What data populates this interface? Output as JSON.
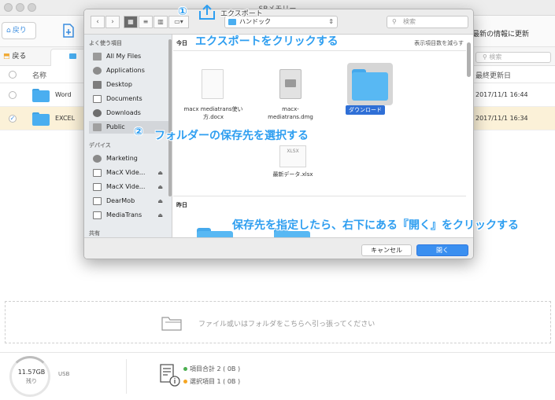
{
  "window": {
    "title": "SBメモリー"
  },
  "toolbar": {
    "back_label": "戻り",
    "refresh_label": "最新の情報に更新",
    "export_label": "エクスポート"
  },
  "crumb": {
    "back_label": "戻る"
  },
  "main_search": {
    "placeholder": "検索"
  },
  "table": {
    "col_name": "名称",
    "col_date": "最終更新日",
    "rows": [
      {
        "name": "Word",
        "date": "2017/11/1  16:44",
        "selected": false
      },
      {
        "name": "EXCEL",
        "date": "2017/11/1  16:34",
        "selected": true
      }
    ]
  },
  "dropzone": {
    "text": "ファイル或いはフォルダをこちらへ引っ張ってください"
  },
  "footer": {
    "storage_size": "11.57GB",
    "storage_unit": "残り",
    "device": "USB",
    "total": "項目合計 2 ( 0B )",
    "selected": "選択項目 1 ( 0B )",
    "colors": {
      "total": "#4caf50",
      "selected": "#f5a623"
    }
  },
  "dialog": {
    "location": "ハンドック",
    "search_placeholder": "検索",
    "sidebar": {
      "favorites_header": "よく使う項目",
      "favorites": [
        "All My Files",
        "Applications",
        "Desktop",
        "Documents",
        "Downloads",
        "Public"
      ],
      "devices_header": "デバイス",
      "devices": [
        "Marketing",
        "MacX Vide...",
        "MacX Vide...",
        "DearMob",
        "MediaTrans"
      ],
      "shared_header": "共有"
    },
    "today_header": "今日",
    "show_fewer": "表示項目数を減らす",
    "files": {
      "doc": "macx mediatrans使い方.docx",
      "dmg": "macx-mediatrans.dmg",
      "folder": "ダウンロード",
      "xlsx_badge": "XLSX",
      "xlsx": "最新データ.xlsx"
    },
    "yesterday_header": "昨日",
    "cancel_label": "キャンセル",
    "open_label": "開く"
  },
  "annotations": {
    "step1_num": "①",
    "step1_text": "エクスポートをクリックする",
    "step2_num": "②",
    "step2_text": "フォルダーの保存先を選択する",
    "step3_text": "保存先を指定したら、右下にある『開く』をクリックする"
  }
}
